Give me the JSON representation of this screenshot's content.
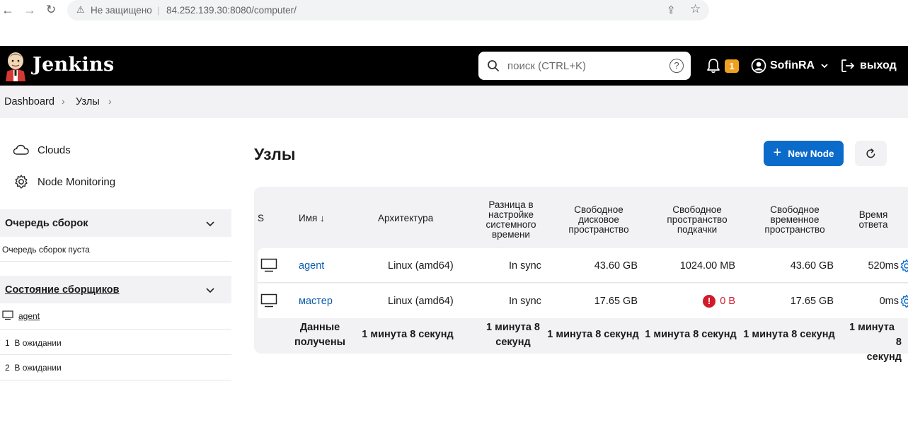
{
  "browser": {
    "insecure_label": "Не защищено",
    "url": "84.252.139.30:8080/computer/"
  },
  "header": {
    "brand": "Jenkins",
    "search_placeholder": "поиск (CTRL+K)",
    "notifications_count": "1",
    "username": "SofinRA",
    "logout_label": "выход",
    "accent_color": "#f0a020"
  },
  "breadcrumb": {
    "items": [
      "Dashboard",
      "Узлы"
    ]
  },
  "sidebar": {
    "items": [
      {
        "label": "Clouds",
        "icon": "cloud-icon"
      },
      {
        "label": "Node Monitoring",
        "icon": "gear-icon"
      }
    ],
    "build_queue": {
      "title": "Очередь сборок",
      "empty_text": "Очередь сборок пуста"
    },
    "executors": {
      "title": "Состояние сборщиков",
      "node": "agent",
      "rows": [
        {
          "num": "1",
          "status": "В ожидании"
        },
        {
          "num": "2",
          "status": "В ожидании"
        }
      ]
    }
  },
  "main": {
    "title": "Узлы",
    "new_node_label": "New Node",
    "primary_color": "#0b6bcb",
    "table": {
      "headers": {
        "s": "S",
        "name": "Имя ↓",
        "arch": "Архитектура",
        "clock": [
          "Разница в",
          "настройке",
          "системного",
          "времени"
        ],
        "disk": [
          "Свободное",
          "дисковое",
          "пространство"
        ],
        "swap": [
          "Свободное",
          "пространство",
          "подкачки"
        ],
        "temp": [
          "Свободное",
          "временное",
          "пространство"
        ],
        "response": [
          "Время",
          "ответа"
        ]
      },
      "rows": [
        {
          "name": "agent",
          "arch": "Linux (amd64)",
          "clock": "In sync",
          "disk": "43.60 GB",
          "swap": "1024.00 MB",
          "temp": "43.60 GB",
          "response": "520ms"
        },
        {
          "name": "мастер",
          "arch": "Linux (amd64)",
          "clock": "In sync",
          "disk": "17.65 GB",
          "swap": "0 B",
          "temp": "17.65 GB",
          "response": "0ms"
        }
      ],
      "footer": {
        "label": [
          "Данные",
          "получены"
        ],
        "arch": "1 минута 8 секунд",
        "clock": [
          "1 минута 8",
          "секунд"
        ],
        "disk": "1 минута 8 секунд",
        "swap": "1 минута 8 секунд",
        "temp": "1 минута 8 секунд",
        "response": [
          "1 минута",
          "8",
          "секунд"
        ]
      }
    }
  }
}
